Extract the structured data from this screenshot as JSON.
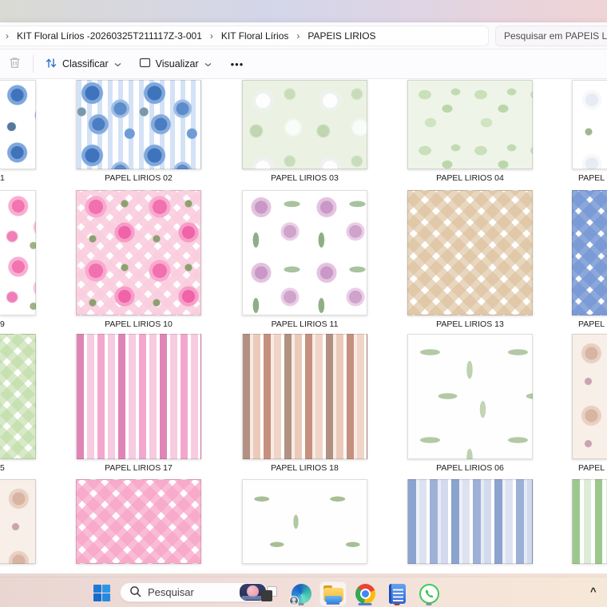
{
  "breadcrumb": {
    "leading_separator": "›",
    "separator": "›",
    "items": [
      "KIT Floral Lírios -20260325T211117Z-3-001",
      "KIT Floral Lírios",
      "PAPEIS LIRIOS"
    ]
  },
  "address_search": {
    "placeholder": "Pesquisar em PAPEIS LIRIO"
  },
  "toolbar": {
    "sort_label": "Classificar",
    "view_label": "Visualizar",
    "more_label": "•••"
  },
  "grid": {
    "rows": [
      {
        "cells": [
          {
            "label": "1",
            "pattern": "blue-floral"
          },
          {
            "label": "PAPEL LIRIOS 02",
            "pattern": "blue-stripe-floral"
          },
          {
            "label": "PAPEL LIRIOS 03",
            "pattern": "green-lily"
          },
          {
            "label": "PAPEL LIRIOS 04",
            "pattern": "green-leaves"
          },
          {
            "label": "PAPEL L",
            "pattern": "white-lily"
          }
        ]
      },
      {
        "cells": [
          {
            "label": "9",
            "pattern": "pink-floral-white"
          },
          {
            "label": "PAPEL LIRIOS 10",
            "pattern": "pink-gingham-floral"
          },
          {
            "label": "PAPEL LIRIOS 11",
            "pattern": "lilac-palm"
          },
          {
            "label": "PAPEL LIRIOS 13",
            "pattern": "beige-gingham"
          },
          {
            "label": "PAPEL L",
            "pattern": "blue-gingham"
          }
        ]
      },
      {
        "cells": [
          {
            "label": "5",
            "pattern": "green-gingham"
          },
          {
            "label": "PAPEL LIRIOS 17",
            "pattern": "pink-stripes"
          },
          {
            "label": "PAPEL LIRIOS 18",
            "pattern": "brown-stripes"
          },
          {
            "label": "PAPEL LIRIOS 06",
            "pattern": "palm-fronds"
          },
          {
            "label": "PAPEL L",
            "pattern": "beige-floral"
          }
        ]
      },
      {
        "cells": [
          {
            "pattern": "beige-floral"
          },
          {
            "pattern": "pink-gingham"
          },
          {
            "pattern": "green-sprigs"
          },
          {
            "pattern": "blue-stripes"
          },
          {
            "pattern": "green-stripes"
          }
        ]
      }
    ]
  },
  "taskbar": {
    "search_placeholder": "Pesquisar",
    "tray_chevron": "^"
  },
  "colors": {
    "accent_blue": "#3170cd",
    "taskbar_gradient_left": "#e9d6d1",
    "taskbar_gradient_right": "#f6e8d8"
  }
}
